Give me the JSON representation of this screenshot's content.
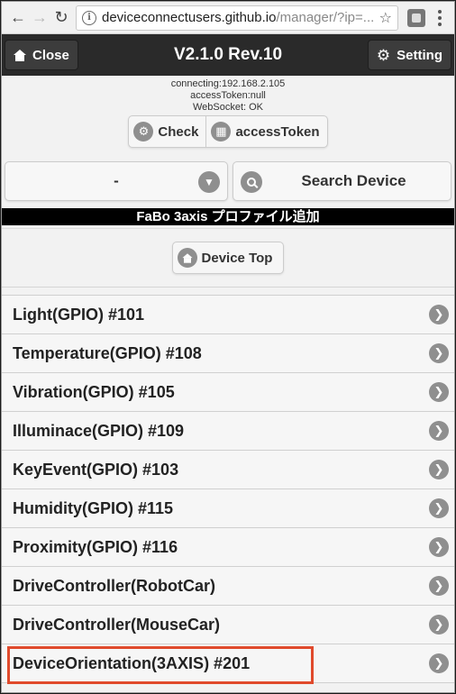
{
  "browser": {
    "url_host": "deviceconnectusers.github.io",
    "url_path": "/manager/?ip=..."
  },
  "header": {
    "close_label": "Close",
    "title": "V2.1.0 Rev.10",
    "setting_label": "Setting"
  },
  "status": {
    "connecting": "connecting:192.168.2.105",
    "access_token": "accessToken:null",
    "websocket": "WebSocket: OK"
  },
  "actions": {
    "check_label": "Check",
    "access_token_label": "accessToken"
  },
  "device_select": {
    "selected": "-"
  },
  "search_label": "Search Device",
  "profile_title": "FaBo 3axis プロファイル追加",
  "device_top_label": "Device Top",
  "profiles": [
    "Light(GPIO) #101",
    "Temperature(GPIO) #108",
    "Vibration(GPIO) #105",
    "Illuminace(GPIO) #109",
    "KeyEvent(GPIO) #103",
    "Humidity(GPIO) #115",
    "Proximity(GPIO) #116",
    "DriveController(RobotCar)",
    "DriveController(MouseCar)",
    "DeviceOrientation(3AXIS) #201"
  ],
  "highlight_color": "#e04a2c"
}
